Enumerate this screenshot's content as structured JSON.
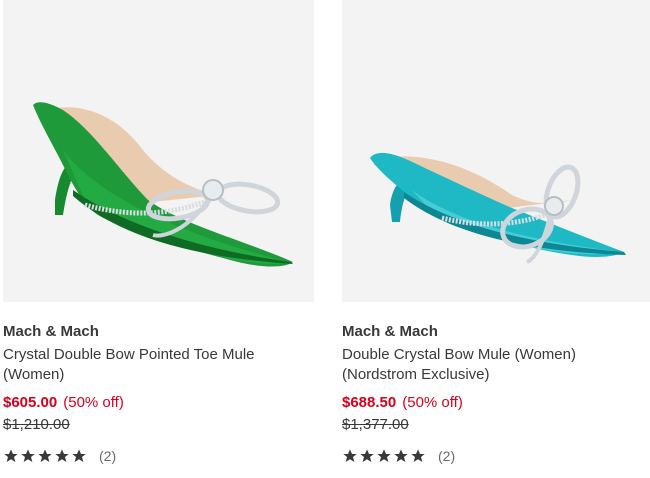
{
  "products": [
    {
      "brand": "Mach & Mach",
      "name": "Crystal Double Bow Pointed Toe Mule (Women)",
      "sale_price": "$605.00",
      "discount": "(50% off)",
      "original_price": "$1,210.00",
      "rating": 5,
      "review_count": "(2)",
      "image": "green-crystal-bow-mule",
      "shoe_color": "#1f9a3a"
    },
    {
      "brand": "Mach & Mach",
      "name": "Double Crystal Bow Mule (Women) (Nordstrom Exclusive)",
      "sale_price": "$688.50",
      "discount": "(50% off)",
      "original_price": "$1,377.00",
      "rating": 5,
      "review_count": "(2)",
      "image": "turquoise-crystal-bow-mule",
      "shoe_color": "#1fb9c6"
    }
  ],
  "colors": {
    "sale": "#d6001c",
    "text": "#393939",
    "image_bg": "#f3f3f3"
  }
}
